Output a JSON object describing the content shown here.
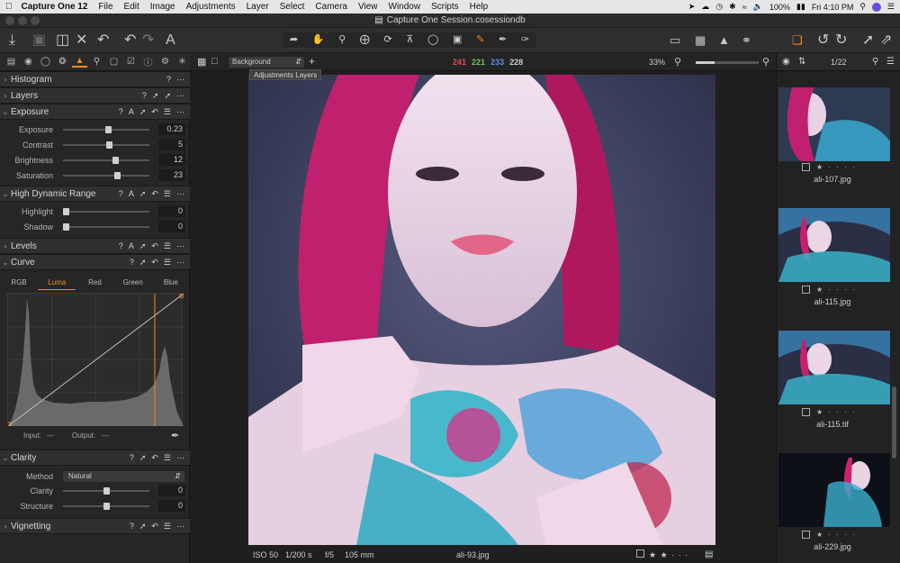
{
  "menubar": {
    "app": "Capture One 12",
    "items": [
      "File",
      "Edit",
      "Image",
      "Adjustments",
      "Layer",
      "Select",
      "Camera",
      "View",
      "Window",
      "Scripts",
      "Help"
    ],
    "battery": "100%",
    "time": "Fri 4:10 PM"
  },
  "window": {
    "title": "Capture One Session.cosessiondb"
  },
  "viewer": {
    "layer_select": "Background",
    "tooltip": "Adjustments Layers",
    "rgb": {
      "r": "241",
      "g": "221",
      "b": "233",
      "a": "228"
    },
    "zoom": "33%",
    "zoom_level": 0.3,
    "info": {
      "iso": "ISO 50",
      "shutter": "1/200 s",
      "aperture": "f/5",
      "focal": "105 mm",
      "filename": "ali-93.jpg"
    },
    "rating_stars": "★ ★ · · ·"
  },
  "browser": {
    "count": "1/22",
    "items": [
      {
        "name": "ali-107.jpg",
        "stars": "★ · · · ·"
      },
      {
        "name": "ali-115.jpg",
        "stars": "★ · · · ·"
      },
      {
        "name": "ali-115.tif",
        "stars": "★ · · · ·"
      },
      {
        "name": "ali-229.jpg",
        "stars": "★ · · · ·"
      }
    ]
  },
  "sections": {
    "histogram": "Histogram",
    "layers": "Layers",
    "exposure": "Exposure",
    "hdr": "High Dynamic Range",
    "levels": "Levels",
    "curve": "Curve",
    "clarity": "Clarity",
    "vignetting": "Vignetting"
  },
  "exposure": [
    {
      "label": "Exposure",
      "value": "0.23",
      "pos": 0.52
    },
    {
      "label": "Contrast",
      "value": "5",
      "pos": 0.53
    },
    {
      "label": "Brightness",
      "value": "12",
      "pos": 0.6
    },
    {
      "label": "Saturation",
      "value": "23",
      "pos": 0.62
    }
  ],
  "hdr": [
    {
      "label": "Highlight",
      "value": "0",
      "pos": 0.03
    },
    {
      "label": "Shadow",
      "value": "0",
      "pos": 0.03
    }
  ],
  "curve": {
    "tabs": [
      "RGB",
      "Luma",
      "Red",
      "Green",
      "Blue"
    ],
    "active_tab": "Luma",
    "input_label": "Input:",
    "input_value": "---",
    "output_label": "Output:",
    "output_value": "---"
  },
  "clarity": {
    "method_label": "Method",
    "method_value": "Natural",
    "rows": [
      {
        "label": "Clarity",
        "value": "0",
        "pos": 0.5
      },
      {
        "label": "Structure",
        "value": "0",
        "pos": 0.5
      }
    ]
  },
  "colors": {
    "accent": "#f28b1e",
    "red": "#e0524a",
    "green": "#6fc35a",
    "blue": "#5a8fe0"
  }
}
